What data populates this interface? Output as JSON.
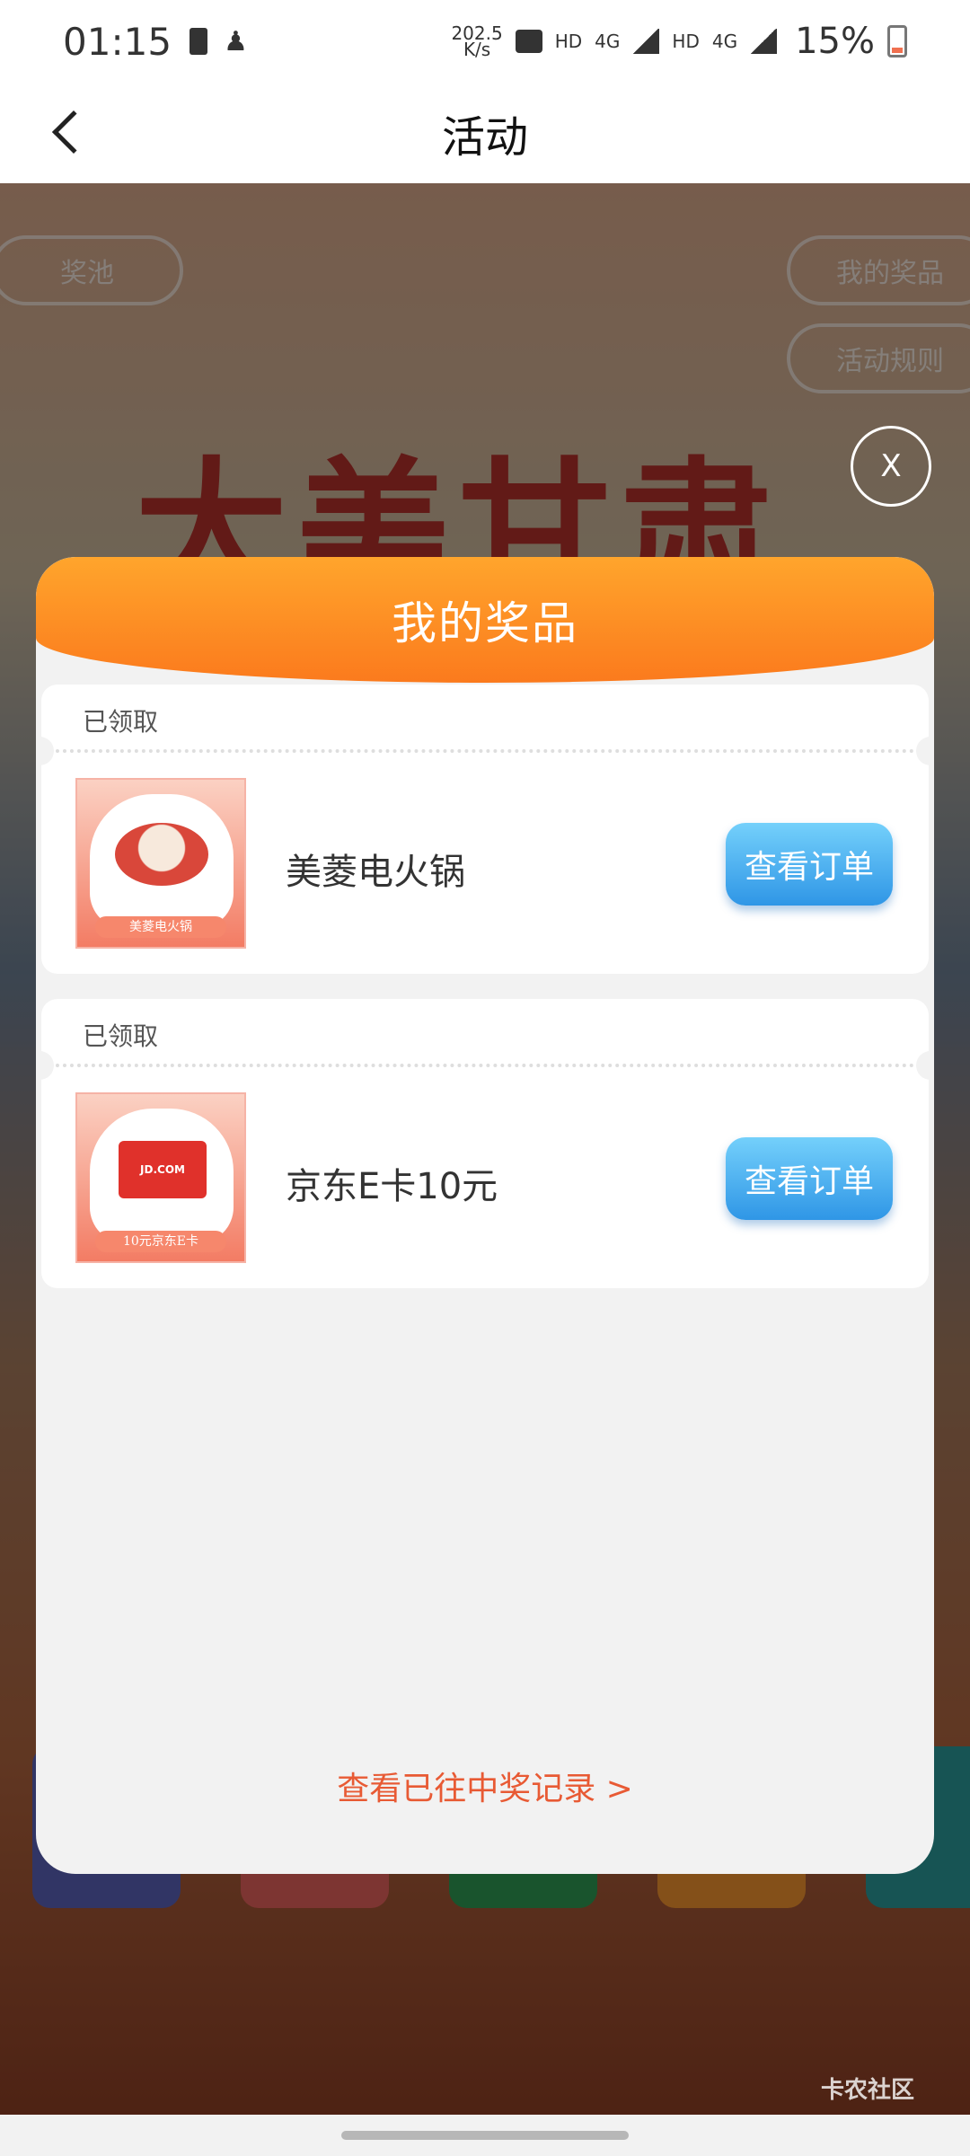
{
  "status_bar": {
    "time": "01:15",
    "net_speed": "202.5\nK/s",
    "hd1": "HD",
    "net1": "4G",
    "hd2": "HD",
    "net2": "4G",
    "battery": "15%"
  },
  "header": {
    "title": "活动"
  },
  "background": {
    "pill_pool": "奖池",
    "pill_my_prizes": "我的奖品",
    "pill_rules": "活动规则",
    "title": "大美甘肃",
    "watermark": "卡农社区"
  },
  "close_label": "X",
  "modal": {
    "title": "我的奖品",
    "prizes": [
      {
        "status": "已领取",
        "name": "美菱电火锅",
        "thumb_label": "美菱电火锅",
        "button": "查看订单"
      },
      {
        "status": "已领取",
        "name": "京东E卡10元",
        "thumb_label": "10元京东E卡",
        "thumb_card_text": "JD.COM",
        "button": "查看订单"
      }
    ],
    "history_link": "查看已往中奖记录 >"
  },
  "colors": {
    "header_orange": "#fb7a1d",
    "button_blue": "#2f96e6",
    "link_red": "#e85a34"
  }
}
